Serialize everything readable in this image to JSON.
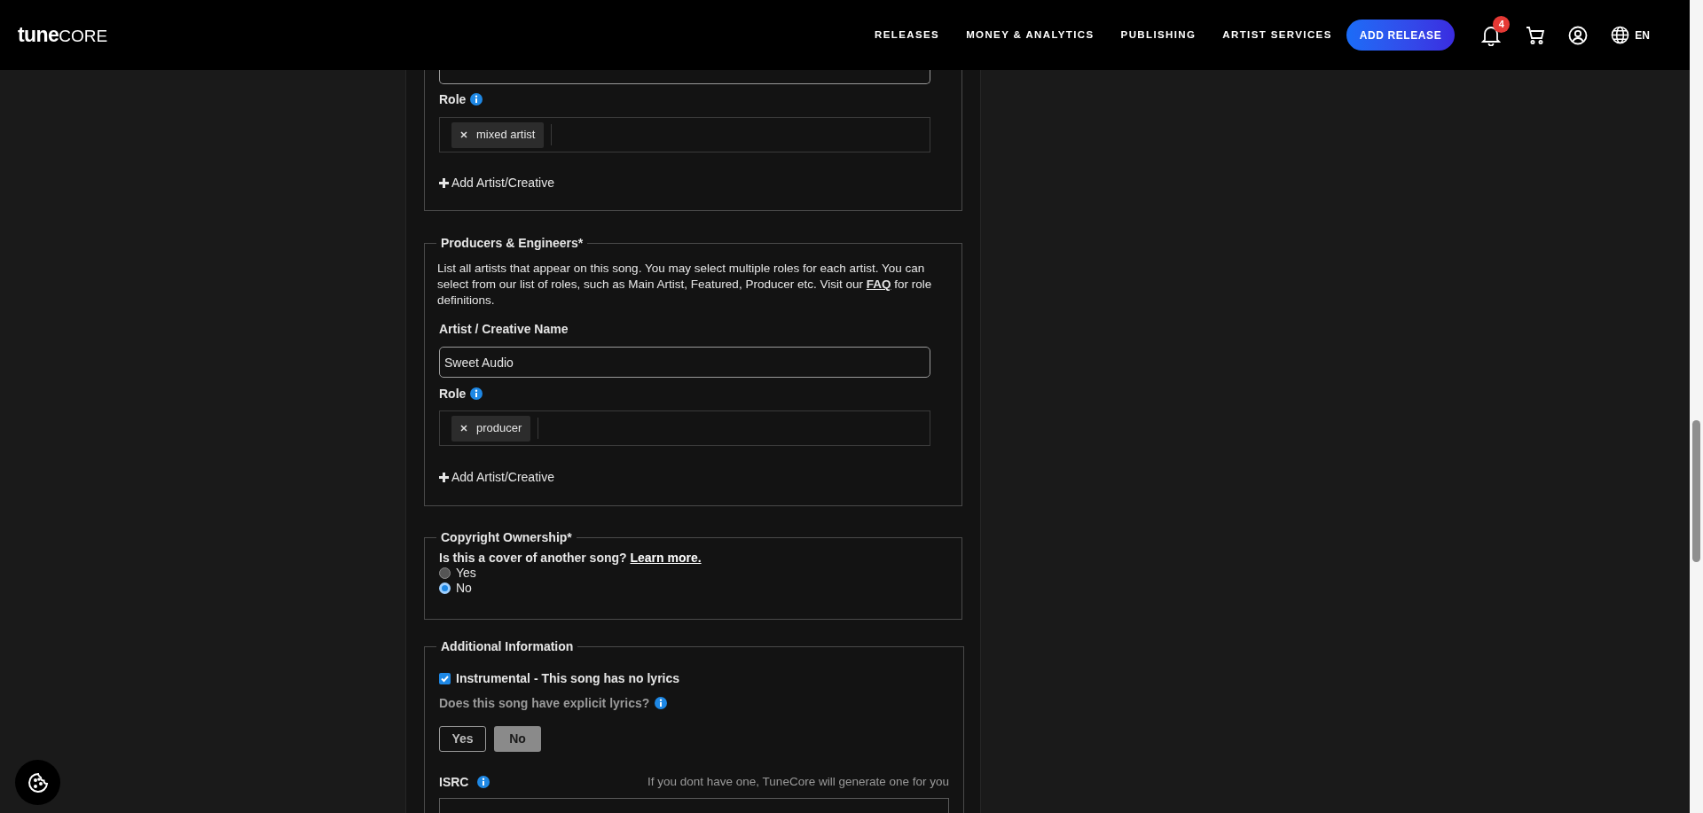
{
  "header": {
    "logo_bold": "tune",
    "logo_light": "CORE",
    "nav": [
      "RELEASES",
      "MONEY & ANALYTICS",
      "PUBLISHING",
      "ARTIST SERVICES"
    ],
    "cta": "ADD RELEASE",
    "notification_count": "4",
    "language": "EN"
  },
  "artists": {
    "role_label": "Role",
    "roles": [
      "mixed artist"
    ],
    "add_label": "Add Artist/Creative"
  },
  "producers": {
    "legend": "Producers & Engineers*",
    "description": "List all artists that appear on this song. You may select multiple roles for each artist. You can select from our list of roles, such as Main Artist, Featured, Producer etc. Visit our ",
    "link": "FAQ",
    "description_end": " for role definitions.",
    "name_label": "Artist / Creative Name",
    "name_value": "Sweet Audio",
    "role_label": "Role",
    "roles": [
      "producer"
    ],
    "add_label": "Add Artist/Creative"
  },
  "copyright": {
    "legend": "Copyright Ownership*",
    "question": "Is this a cover of another song?",
    "link": "Learn more.",
    "options": [
      {
        "label": "Yes",
        "selected": false
      },
      {
        "label": "No",
        "selected": true
      }
    ]
  },
  "additional": {
    "legend": "Additional Information",
    "instrumental": {
      "label": "Instrumental - This song has no lyrics",
      "checked": true
    },
    "explicit": {
      "question": "Does this song have explicit lyrics?",
      "disabled": true,
      "options": [
        {
          "label": "Yes",
          "selected": false
        },
        {
          "label": "No",
          "selected": true
        }
      ]
    },
    "isrc_label": "ISRC",
    "isrc_hint": "If you dont have one, TuneCore will generate one for you"
  }
}
